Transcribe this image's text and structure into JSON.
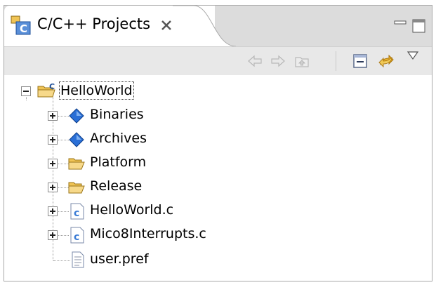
{
  "view": {
    "title": "C/C++ Projects",
    "icons": {
      "tab": "cpp-projects-icon",
      "close": "close-icon",
      "minimize": "minimize-icon",
      "maximize": "maximize-icon"
    }
  },
  "toolbar": {
    "buttons": [
      "back-arrow-icon",
      "forward-arrow-icon",
      "up-folder-icon",
      "collapse-all-icon",
      "link-with-editor-icon",
      "view-menu-icon"
    ]
  },
  "tree": {
    "root": {
      "label": "HelloWorld",
      "icon": "c-project-folder-icon",
      "expanded": true
    },
    "children": [
      {
        "label": "Binaries",
        "icon": "binaries-diamond-icon",
        "expandable": true
      },
      {
        "label": "Archives",
        "icon": "archives-diamond-icon",
        "expandable": true
      },
      {
        "label": "Platform",
        "icon": "folder-icon",
        "expandable": true
      },
      {
        "label": "Release",
        "icon": "folder-icon",
        "expandable": true
      },
      {
        "label": "HelloWorld.c",
        "icon": "c-file-icon",
        "expandable": true
      },
      {
        "label": "Mico8Interrupts.c",
        "icon": "c-file-icon",
        "expandable": true
      },
      {
        "label": "user.pref",
        "icon": "text-file-icon",
        "expandable": false
      }
    ]
  },
  "colors": {
    "diamond": "#2a6fd6",
    "folder": "#f0c455",
    "c_file": "#3a7bd5"
  }
}
